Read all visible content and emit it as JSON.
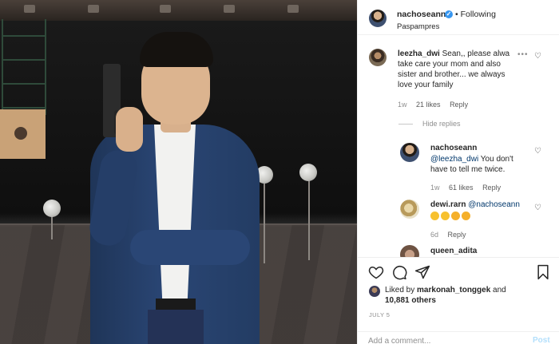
{
  "post": {
    "owner": {
      "username": "nachoseann",
      "following_label": "• Following",
      "location": "Paspampres"
    },
    "comments": [
      {
        "username": "leezha_dwi",
        "text_line1": "Sean,, please alwa",
        "text_line2": "take care your mom and also",
        "text_line3": "sister and brother... we always",
        "text_line4": "love your family",
        "time": "1w",
        "likes": "21 likes",
        "reply": "Reply",
        "more": "•••",
        "hide_replies": "Hide replies"
      },
      {
        "username": "nachoseann",
        "mention": "@leezha_dwi",
        "text_line1": " You don't",
        "text_line2": "have to tell me twice.",
        "time": "1w",
        "likes": "61 likes",
        "reply": "Reply"
      },
      {
        "username": "dewi.rarn",
        "mention": "@nachoseann",
        "emojis": [
          "laugh-emoji",
          "laugh-emoji",
          "heart-eyes-emoji",
          "heart-eyes-emoji"
        ],
        "time": "6d",
        "reply": "Reply"
      },
      {
        "username": "queen_adita"
      }
    ],
    "likes": {
      "prefix": "Liked by ",
      "liker": "markonah_tonggek",
      "suffix": " and",
      "others": "10,881 others"
    },
    "date": "JULY 5",
    "add_comment": {
      "placeholder": "Add a comment...",
      "post_label": "Post"
    },
    "icons": [
      "heart-icon",
      "comment-icon",
      "share-icon",
      "bookmark-icon"
    ],
    "colors": {
      "verified": "#3897f0",
      "mention": "#00376b",
      "muted": "#8e8e8e",
      "post_disabled": "#b2dffc"
    }
  }
}
